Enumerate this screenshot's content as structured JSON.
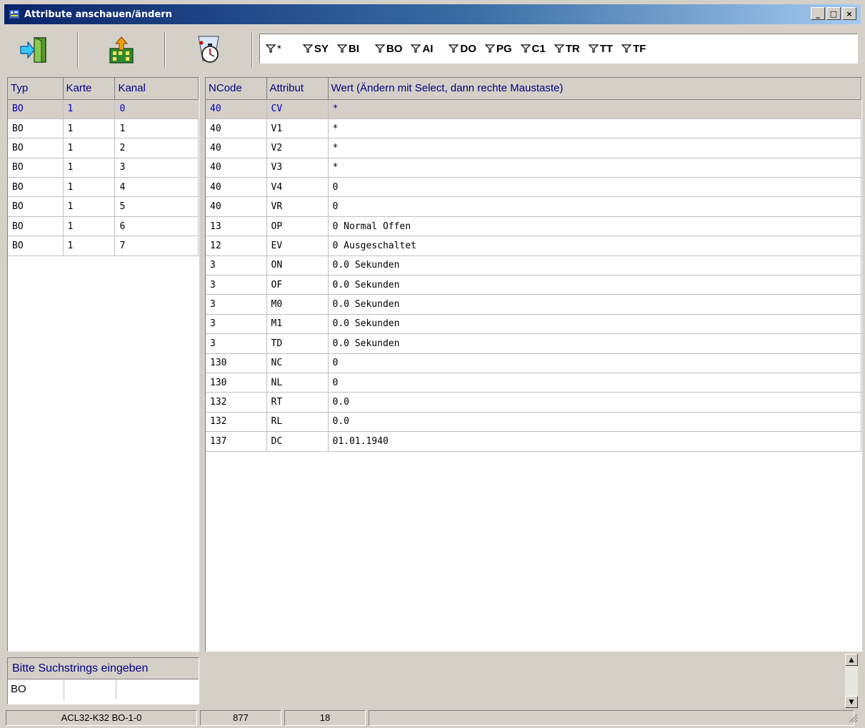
{
  "window": {
    "title": "Attribute anschauen/ändern"
  },
  "toolbar": {
    "buttons": [
      {
        "icon": "exit-door-icon"
      },
      {
        "icon": "upload-factory-icon"
      },
      {
        "icon": "stopwatch-icon"
      }
    ],
    "filters": [
      "*",
      "SY",
      "BI",
      "BO",
      "AI",
      "DO",
      "PG",
      "C1",
      "TR",
      "TT",
      "TF"
    ]
  },
  "left_table": {
    "columns": [
      "Typ",
      "Karte",
      "Kanal"
    ],
    "rows": [
      [
        "BO",
        "1",
        "0"
      ],
      [
        "BO",
        "1",
        "1"
      ],
      [
        "BO",
        "1",
        "2"
      ],
      [
        "BO",
        "1",
        "3"
      ],
      [
        "BO",
        "1",
        "4"
      ],
      [
        "BO",
        "1",
        "5"
      ],
      [
        "BO",
        "1",
        "6"
      ],
      [
        "BO",
        "1",
        "7"
      ]
    ]
  },
  "right_table": {
    "columns": [
      "NCode",
      "Attribut",
      "Wert  (Ändern mit Select, dann rechte Maustaste)"
    ],
    "rows": [
      [
        "40",
        "CV",
        "*"
      ],
      [
        "40",
        "V1",
        "*"
      ],
      [
        "40",
        "V2",
        "*"
      ],
      [
        "40",
        "V3",
        "*"
      ],
      [
        "40",
        "V4",
        "0"
      ],
      [
        "40",
        "VR",
        "0"
      ],
      [
        "13",
        "OP",
        "0 Normal Offen"
      ],
      [
        "12",
        "EV",
        "0 Ausgeschaltet"
      ],
      [
        "3",
        "ON",
        "0.0 Sekunden"
      ],
      [
        "3",
        "OF",
        "0.0 Sekunden"
      ],
      [
        "3",
        "M0",
        "0.0 Sekunden"
      ],
      [
        "3",
        "M1",
        "0.0 Sekunden"
      ],
      [
        "3",
        "TD",
        "0.0 Sekunden"
      ],
      [
        "130",
        "NC",
        "0"
      ],
      [
        "130",
        "NL",
        "0"
      ],
      [
        "132",
        "RT",
        "0.0"
      ],
      [
        "132",
        "RL",
        "0.0"
      ],
      [
        "137",
        "DC",
        "01.01.1940"
      ]
    ]
  },
  "search": {
    "header": "Bitte Suchstrings eingeben",
    "values": [
      "BO",
      "",
      ""
    ]
  },
  "status": {
    "device": "ACL32-K32  BO-1-0",
    "count1": "877",
    "count2": "18"
  },
  "colors": {
    "title_gradient_start": "#0a246a",
    "header_text": "#000080",
    "selected_text": "#0000c0"
  }
}
